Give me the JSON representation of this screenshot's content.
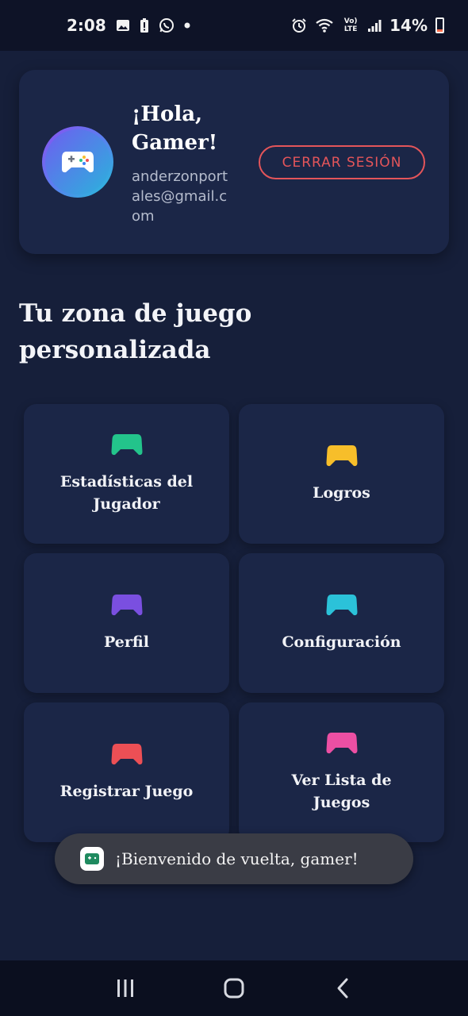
{
  "status_bar": {
    "time": "2:08",
    "battery_percent": "14%",
    "network_label": "Vo) LTE"
  },
  "profile": {
    "greeting": "¡Hola, Gamer!",
    "email": "anderzonportales@gmail.com",
    "logout_label": "CERRAR SESIÓN"
  },
  "section_title": "Tu zona de juego personalizada",
  "tiles": [
    {
      "label": "Estadísticas del Jugador",
      "color": "#23c48b",
      "icon": "gamepad-icon"
    },
    {
      "label": "Logros",
      "color": "#f7be2a",
      "icon": "gamepad-icon"
    },
    {
      "label": "Perfil",
      "color": "#7a4fe0",
      "icon": "gamepad-icon"
    },
    {
      "label": "Configuración",
      "color": "#2bc2d9",
      "icon": "gamepad-icon"
    },
    {
      "label": "Registrar Juego",
      "color": "#ec4f55",
      "icon": "gamepad-icon"
    },
    {
      "label": "Ver Lista de Juegos",
      "color": "#ec4fa3",
      "icon": "gamepad-icon"
    }
  ],
  "toast": {
    "message": "¡Bienvenido de vuelta, gamer!"
  },
  "colors": {
    "background": "#161f3a",
    "card": "#1b2647",
    "accent_red": "#e4555a"
  }
}
